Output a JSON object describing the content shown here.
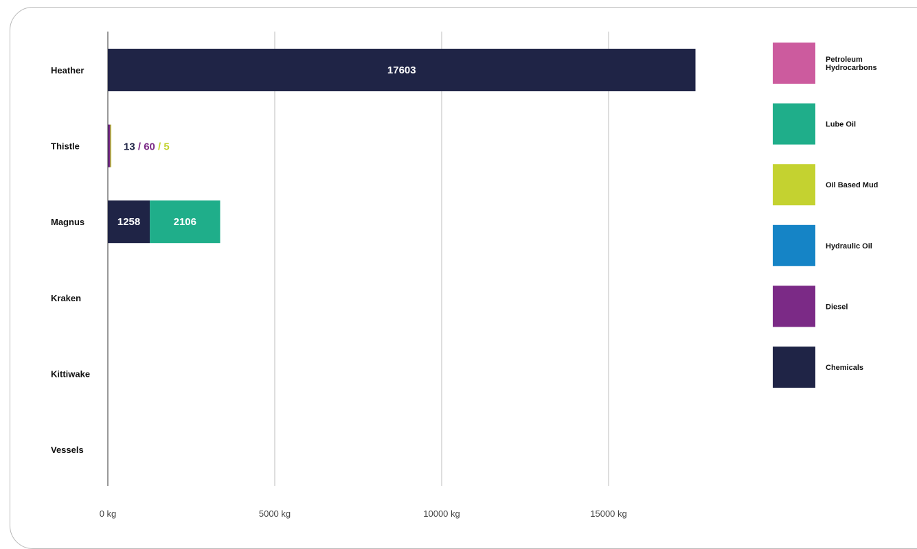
{
  "chart_data": {
    "type": "bar",
    "orientation": "horizontal",
    "stacked": true,
    "categories": [
      "Heather",
      "Thistle",
      "Magnus",
      "Kraken",
      "Kittiwake",
      "Vessels"
    ],
    "series": [
      {
        "name": "Chemicals",
        "color": "#1f2446",
        "values": [
          17603,
          13,
          1258,
          0,
          0,
          0
        ]
      },
      {
        "name": "Diesel",
        "color": "#7b2a86",
        "values": [
          0,
          60,
          0,
          0,
          0,
          0
        ]
      },
      {
        "name": "Hydraulic Oil",
        "color": "#1584c6",
        "values": [
          0,
          0,
          0,
          0,
          0,
          0
        ]
      },
      {
        "name": "Oil Based Mud",
        "color": "#c4d230",
        "values": [
          0,
          5,
          0,
          0,
          0,
          0
        ]
      },
      {
        "name": "Lube Oil",
        "color": "#1fae8a",
        "values": [
          0,
          0,
          2106,
          0,
          0,
          0
        ]
      },
      {
        "name": "Petroleum Hydrocarbons",
        "color": "#cc5b9e",
        "values": [
          0,
          0,
          0,
          0,
          0,
          0
        ]
      }
    ],
    "xlim": [
      0,
      20000
    ],
    "xticks": [
      0,
      5000,
      10000,
      15000
    ],
    "tick_labels": [
      "0 kg",
      "5000 kg",
      "10000 kg",
      "15000 kg"
    ],
    "grid": true,
    "legend_position": "right",
    "legend_order": [
      "Petroleum Hydrocarbons",
      "Lube Oil",
      "Oil Based Mud",
      "Hydraulic Oil",
      "Diesel",
      "Chemicals"
    ],
    "legend_lines": {
      "Petroleum Hydrocarbons": [
        "Petroleum",
        "Hydrocarbons"
      ]
    },
    "annotations": [
      {
        "category": "Thistle",
        "parts": [
          {
            "text": "13",
            "color": "#1f2446"
          },
          {
            "text": " / ",
            "color": "#7b2a86"
          },
          {
            "text": "60",
            "color": "#7b2a86"
          },
          {
            "text": " / ",
            "color": "#c4d230"
          },
          {
            "text": "5",
            "color": "#c4d230"
          }
        ]
      }
    ]
  }
}
